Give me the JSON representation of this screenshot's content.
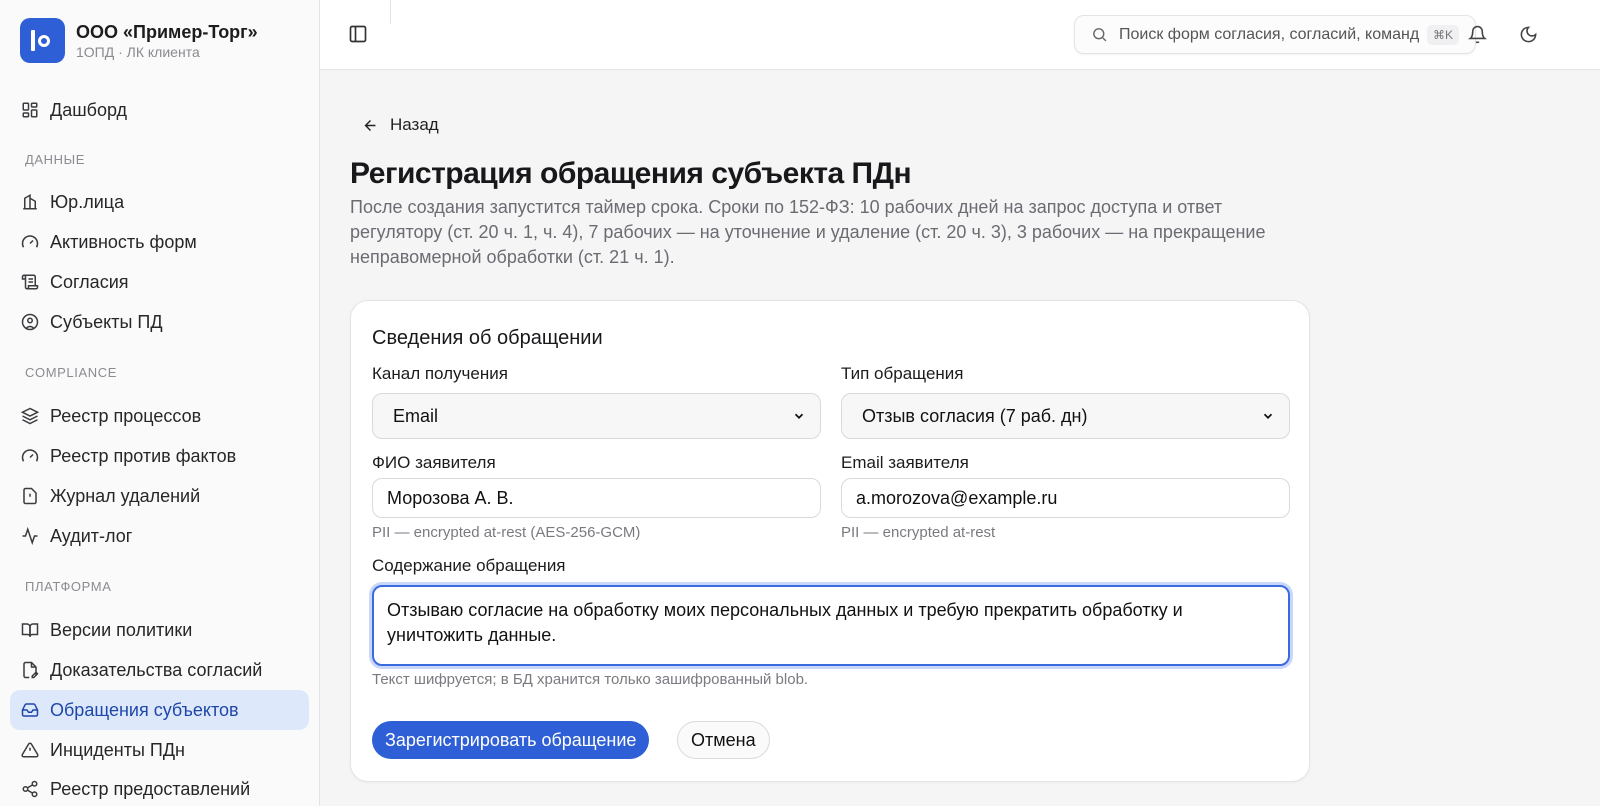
{
  "org": {
    "name": "ООО «Пример-Торг»",
    "subtitle": "1ОПД · ЛК клиента"
  },
  "sidebar": {
    "sections": [
      "ДАННЫЕ",
      "COMPLIANCE",
      "ПЛАТФОРМА"
    ],
    "items": [
      {
        "label": "Дашборд",
        "icon": "dashboard-icon"
      },
      {
        "label": "Юр.лица",
        "icon": "building-icon"
      },
      {
        "label": "Активность форм",
        "icon": "gauge-icon"
      },
      {
        "label": "Согласия",
        "icon": "scroll-icon"
      },
      {
        "label": "Субъекты ПД",
        "icon": "user-circle-icon"
      },
      {
        "label": "Реестр процессов",
        "icon": "layers-icon"
      },
      {
        "label": "Реестр против фактов",
        "icon": "gauge-icon"
      },
      {
        "label": "Журнал удалений",
        "icon": "file-alert-icon"
      },
      {
        "label": "Аудит-лог",
        "icon": "activity-icon"
      },
      {
        "label": "Версии политики",
        "icon": "book-icon"
      },
      {
        "label": "Доказательства согласий",
        "icon": "file-signature-icon"
      },
      {
        "label": "Обращения субъектов",
        "icon": "inbox-icon"
      },
      {
        "label": "Инциденты ПДн",
        "icon": "warning-icon"
      },
      {
        "label": "Реестр предоставлений",
        "icon": "share-icon"
      }
    ]
  },
  "header": {
    "search_placeholder": "Поиск форм согласия, согласий, команд",
    "shortcut": "⌘K"
  },
  "main": {
    "back_label": "Назад",
    "title": "Регистрация обращения субъекта ПДн",
    "description": "После создания запустится таймер срока. Сроки по 152-ФЗ: 10 рабочих дней на запрос доступа и ответ регулятору (ст. 20 ч. 1, ч. 4), 7 рабочих — на уточнение и удаление (ст. 20 ч. 3), 3 рабочих — на прекращение неправомерной обработки (ст. 21 ч. 1).",
    "card": {
      "title": "Сведения об обращении",
      "channel_label": "Канал получения",
      "channel_value": "Email",
      "type_label": "Тип обращения",
      "type_value": "Отзыв согласия (7 раб. дн)",
      "name_label": "ФИО заявителя",
      "name_value": "Морозова А. В.",
      "name_hint": "PII — encrypted at-rest (AES-256-GCM)",
      "email_label": "Email заявителя",
      "email_value": "a.morozova@example.ru",
      "email_hint": "PII — encrypted at-rest",
      "content_label": "Содержание обращения",
      "content_value": "Отзываю согласие на обработку моих персональных данных и требую прекратить обработку и уничтожить данные.",
      "content_hint": "Текст шифруется; в БД хранится только зашифрованный blob.",
      "submit_label": "Зарегистрировать обращение",
      "cancel_label": "Отмена"
    }
  },
  "colors": {
    "accent": "#2f5fd6",
    "active_bg": "#dde9fb"
  }
}
